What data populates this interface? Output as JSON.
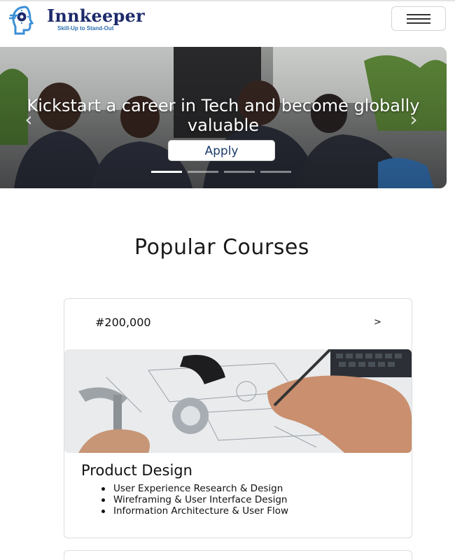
{
  "header": {
    "brand_name": "Innkeeper",
    "brand_tagline": "Skill-Up to Stand-Out",
    "menu_icon": "hamburger-icon"
  },
  "hero": {
    "headline": "Kickstart a career in Tech and become globally valuable",
    "apply_label": "Apply",
    "prev_icon": "chevron-left-icon",
    "next_icon": "chevron-right-icon",
    "slide_count": 4,
    "active_slide": 1
  },
  "courses": {
    "title": "Popular Courses",
    "items": [
      {
        "price": "#200,000",
        "chevron": ">",
        "name": "Product Design",
        "outline": [
          "User Experience Research & Design",
          "Wireframing & User Interface Design",
          "Information Architecture & User Flow"
        ]
      }
    ]
  },
  "colors": {
    "brand_navy": "#1d2a6b",
    "brand_blue": "#2d6fb0",
    "apply_text": "#1c3b6b"
  }
}
